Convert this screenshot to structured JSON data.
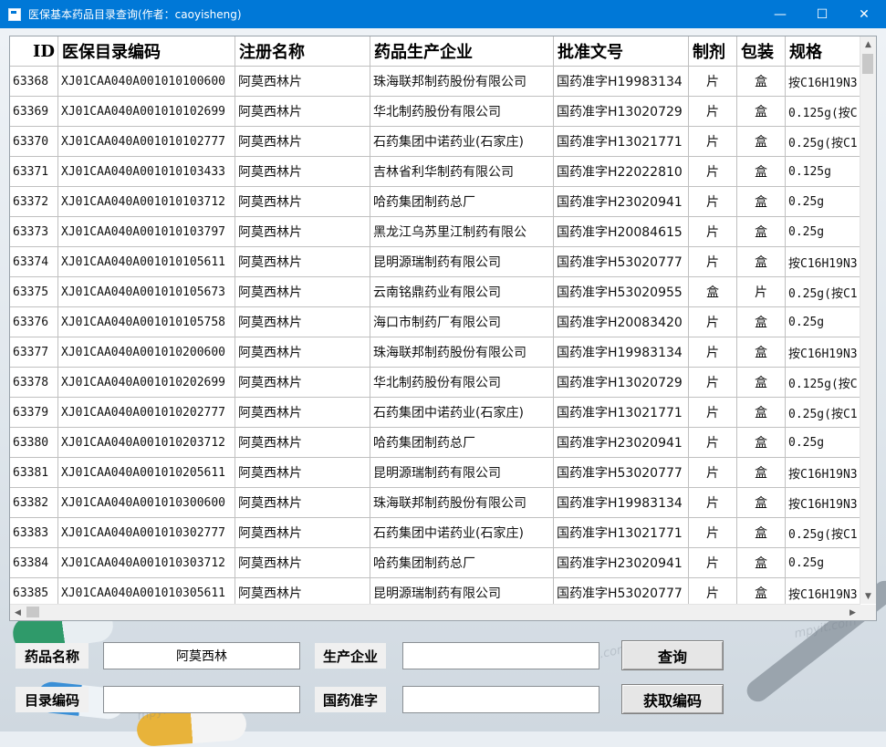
{
  "window": {
    "title": "医保基本药品目录查询(作者：caoyisheng)",
    "controls": {
      "minimize": "—",
      "maximize": "☐",
      "close": "✕"
    }
  },
  "table": {
    "columns": [
      {
        "key": "id",
        "label": "ID"
      },
      {
        "key": "code",
        "label": "医保目录编码"
      },
      {
        "key": "name",
        "label": "注册名称"
      },
      {
        "key": "maker",
        "label": "药品生产企业"
      },
      {
        "key": "approval",
        "label": "批准文号"
      },
      {
        "key": "form",
        "label": "制剂"
      },
      {
        "key": "pack",
        "label": "包装"
      },
      {
        "key": "spec",
        "label": "规格"
      }
    ],
    "rows": [
      [
        "63368",
        "XJ01CAA040A001010100600",
        "阿莫西林片",
        "珠海联邦制药股份有限公司",
        "国药准字H19983134",
        "片",
        "盒",
        "按C16H19N3"
      ],
      [
        "63369",
        "XJ01CAA040A001010102699",
        "阿莫西林片",
        "华北制药股份有限公司",
        "国药准字H13020729",
        "片",
        "盒",
        "0.125g(按C"
      ],
      [
        "63370",
        "XJ01CAA040A001010102777",
        "阿莫西林片",
        "石药集团中诺药业(石家庄)",
        "国药准字H13021771",
        "片",
        "盒",
        "0.25g(按C1"
      ],
      [
        "63371",
        "XJ01CAA040A001010103433",
        "阿莫西林片",
        "吉林省利华制药有限公司",
        "国药准字H22022810",
        "片",
        "盒",
        "0.125g"
      ],
      [
        "63372",
        "XJ01CAA040A001010103712",
        "阿莫西林片",
        "哈药集团制药总厂",
        "国药准字H23020941",
        "片",
        "盒",
        "0.25g"
      ],
      [
        "63373",
        "XJ01CAA040A001010103797",
        "阿莫西林片",
        "黑龙江乌苏里江制药有限公",
        "国药准字H20084615",
        "片",
        "盒",
        "0.25g"
      ],
      [
        "63374",
        "XJ01CAA040A001010105611",
        "阿莫西林片",
        "昆明源瑞制药有限公司",
        "国药准字H53020777",
        "片",
        "盒",
        "按C16H19N3"
      ],
      [
        "63375",
        "XJ01CAA040A001010105673",
        "阿莫西林片",
        "云南铭鼎药业有限公司",
        "国药准字H53020955",
        "盒",
        "片",
        "0.25g(按C1"
      ],
      [
        "63376",
        "XJ01CAA040A001010105758",
        "阿莫西林片",
        "海口市制药厂有限公司",
        "国药准字H20083420",
        "片",
        "盒",
        "0.25g"
      ],
      [
        "63377",
        "XJ01CAA040A001010200600",
        "阿莫西林片",
        "珠海联邦制药股份有限公司",
        "国药准字H19983134",
        "片",
        "盒",
        "按C16H19N3"
      ],
      [
        "63378",
        "XJ01CAA040A001010202699",
        "阿莫西林片",
        "华北制药股份有限公司",
        "国药准字H13020729",
        "片",
        "盒",
        "0.125g(按C"
      ],
      [
        "63379",
        "XJ01CAA040A001010202777",
        "阿莫西林片",
        "石药集团中诺药业(石家庄)",
        "国药准字H13021771",
        "片",
        "盒",
        "0.25g(按C1"
      ],
      [
        "63380",
        "XJ01CAA040A001010203712",
        "阿莫西林片",
        "哈药集团制药总厂",
        "国药准字H23020941",
        "片",
        "盒",
        "0.25g"
      ],
      [
        "63381",
        "XJ01CAA040A001010205611",
        "阿莫西林片",
        "昆明源瑞制药有限公司",
        "国药准字H53020777",
        "片",
        "盒",
        "按C16H19N3"
      ],
      [
        "63382",
        "XJ01CAA040A001010300600",
        "阿莫西林片",
        "珠海联邦制药股份有限公司",
        "国药准字H19983134",
        "片",
        "盒",
        "按C16H19N3"
      ],
      [
        "63383",
        "XJ01CAA040A001010302777",
        "阿莫西林片",
        "石药集团中诺药业(石家庄)",
        "国药准字H13021771",
        "片",
        "盒",
        "0.25g(按C1"
      ],
      [
        "63384",
        "XJ01CAA040A001010303712",
        "阿莫西林片",
        "哈药集团制药总厂",
        "国药准字H23020941",
        "片",
        "盒",
        "0.25g"
      ],
      [
        "63385",
        "XJ01CAA040A001010305611",
        "阿莫西林片",
        "昆明源瑞制药有限公司",
        "国药准字H53020777",
        "片",
        "盒",
        "按C16H19N3"
      ]
    ]
  },
  "scroll": {
    "up": "▲",
    "down": "▼",
    "left": "◀",
    "right": "▶"
  },
  "form": {
    "drug_name_label": "药品名称",
    "drug_name_value": "阿莫西林",
    "manufacturer_label": "生产企业",
    "manufacturer_value": "",
    "catalog_code_label": "目录编码",
    "catalog_code_value": "",
    "approval_label": "国药准字",
    "approval_value": "",
    "query_button": "查询",
    "get_code_button": "获取编码"
  },
  "watermark": "mpyit.com",
  "colors": {
    "titlebar": "#0078d7",
    "grid_line": "#c0c0c0",
    "button_face": "#e6e6e6"
  }
}
